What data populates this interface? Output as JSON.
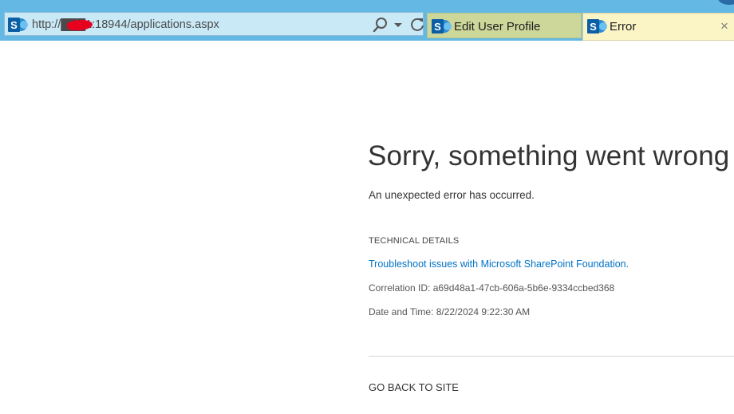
{
  "browser": {
    "address": {
      "url": "http://███1:18944/applications.aspx",
      "favicon": "sharepoint-logo-icon",
      "buttons": [
        "search-icon",
        "chevron-down-icon",
        "refresh-icon"
      ]
    },
    "tabs": [
      {
        "label": "Edit User Profile",
        "icon": "sharepoint-logo-icon",
        "color": "#cdd79a"
      },
      {
        "label": "Error",
        "icon": "sharepoint-logo-icon",
        "color": "#fbf4c5",
        "close": "×"
      }
    ],
    "chrome_color": "#63b8e4"
  },
  "error_page": {
    "title": "Sorry, something went wrong",
    "message": "An unexpected error has occurred.",
    "technical_details_heading": "TECHNICAL DETAILS",
    "troubleshoot_link": "Troubleshoot issues with Microsoft SharePoint Foundation.",
    "correlation_id": "Correlation ID: a69d48a1-47cb-606a-5b6e-9334ccbed368",
    "date_time": "Date and Time: 8/22/2024 9:22:30 AM",
    "go_back_label": "GO BACK TO SITE",
    "link_color": "#0072c6"
  }
}
